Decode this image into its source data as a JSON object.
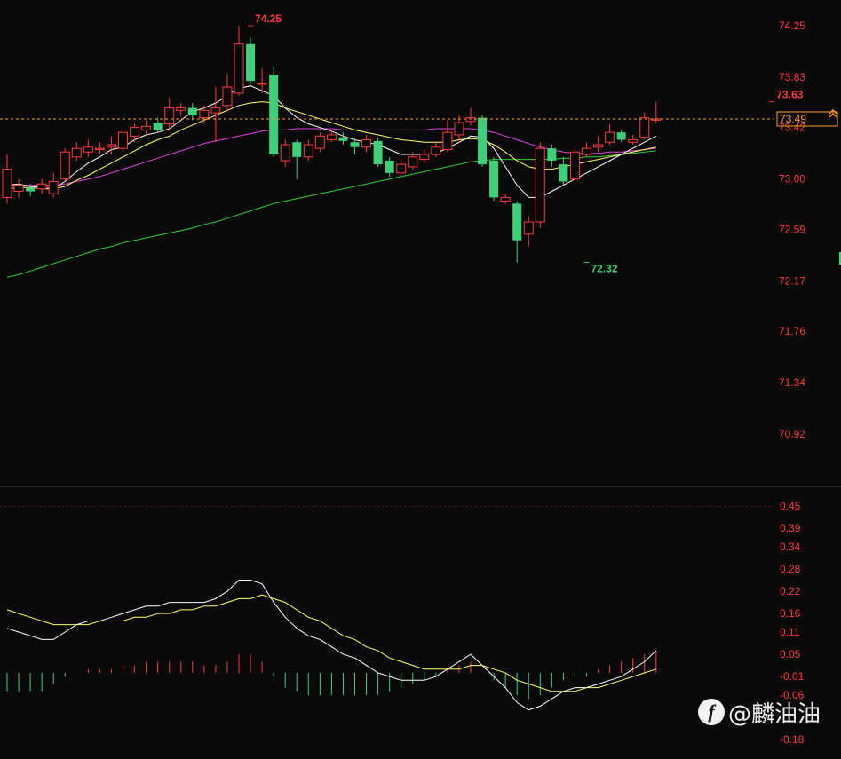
{
  "colors": {
    "background": "#0a0a0a",
    "up": "#ff3b3b",
    "down": "#3fd07a",
    "axis_text": "#ff3b3b",
    "price_line": "#ff9a2e",
    "ma5": "#ffffff",
    "ma10": "#ffff66",
    "ma20": "#e040e0",
    "ma60": "#33cc33",
    "dif": "#ffffff",
    "dea": "#ffff66"
  },
  "chart_data": [
    {
      "type": "candlestick",
      "y_ticks": [
        "74.25",
        "73.83",
        "73.42",
        "73.00",
        "72.59",
        "72.17",
        "71.76",
        "71.34",
        "70.92"
      ],
      "ylim": [
        70.6,
        74.5
      ],
      "grid": false,
      "last_price_label": "73.49",
      "high_marker": {
        "index": 21,
        "value": 74.25,
        "label": "74.25"
      },
      "low_marker": {
        "index": 50,
        "value": 72.32,
        "label": "72.32"
      },
      "recent_high_marker": {
        "index": 66,
        "value": 73.63,
        "label": "73.63"
      },
      "candles": [
        [
          72.85,
          73.08,
          73.2,
          72.8
        ],
        [
          72.9,
          72.95,
          73.0,
          72.85
        ],
        [
          72.93,
          72.9,
          72.96,
          72.86
        ],
        [
          72.92,
          72.96,
          73.0,
          72.88
        ],
        [
          72.88,
          72.98,
          73.05,
          72.85
        ],
        [
          73.0,
          73.22,
          73.25,
          72.98
        ],
        [
          73.18,
          73.25,
          73.3,
          73.15
        ],
        [
          73.22,
          73.26,
          73.32,
          73.18
        ],
        [
          73.24,
          73.25,
          73.3,
          73.2
        ],
        [
          73.26,
          73.28,
          73.35,
          73.2
        ],
        [
          73.25,
          73.38,
          73.4,
          73.22
        ],
        [
          73.35,
          73.42,
          73.45,
          73.3
        ],
        [
          73.4,
          73.43,
          73.48,
          73.36
        ],
        [
          73.46,
          73.4,
          73.5,
          73.38
        ],
        [
          73.45,
          73.58,
          73.66,
          73.4
        ],
        [
          73.56,
          73.58,
          73.62,
          73.52
        ],
        [
          73.58,
          73.52,
          73.62,
          73.48
        ],
        [
          73.5,
          73.56,
          73.6,
          73.45
        ],
        [
          73.54,
          73.58,
          73.75,
          73.3
        ],
        [
          73.6,
          73.75,
          73.86,
          73.55
        ],
        [
          73.7,
          74.1,
          74.25,
          73.68
        ],
        [
          74.1,
          73.8,
          74.15,
          73.78
        ],
        [
          73.78,
          73.78,
          73.9,
          73.7
        ],
        [
          73.85,
          73.2,
          73.92,
          73.18
        ],
        [
          73.15,
          73.28,
          73.32,
          73.1
        ],
        [
          73.3,
          73.18,
          73.32,
          73.0
        ],
        [
          73.18,
          73.28,
          73.32,
          73.15
        ],
        [
          73.25,
          73.35,
          73.38,
          73.22
        ],
        [
          73.32,
          73.36,
          73.4,
          73.3
        ],
        [
          73.34,
          73.31,
          73.38,
          73.28
        ],
        [
          73.3,
          73.26,
          73.33,
          73.2
        ],
        [
          73.26,
          73.32,
          73.36,
          73.22
        ],
        [
          73.31,
          73.12,
          73.34,
          73.1
        ],
        [
          73.15,
          73.05,
          73.18,
          73.02
        ],
        [
          73.05,
          73.12,
          73.16,
          73.02
        ],
        [
          73.1,
          73.18,
          73.22,
          73.08
        ],
        [
          73.16,
          73.2,
          73.24,
          73.14
        ],
        [
          73.2,
          73.26,
          73.3,
          73.18
        ],
        [
          73.24,
          73.38,
          73.48,
          73.22
        ],
        [
          73.36,
          73.46,
          73.52,
          73.32
        ],
        [
          73.47,
          73.5,
          73.58,
          73.44
        ],
        [
          73.5,
          73.12,
          73.52,
          73.1
        ],
        [
          73.15,
          72.85,
          73.18,
          72.82
        ],
        [
          72.82,
          72.85,
          72.88,
          72.8
        ],
        [
          72.8,
          72.5,
          72.82,
          72.32
        ],
        [
          72.55,
          72.65,
          72.7,
          72.45
        ],
        [
          72.65,
          73.25,
          73.3,
          72.6
        ],
        [
          73.25,
          73.15,
          73.28,
          73.1
        ],
        [
          73.12,
          72.98,
          73.18,
          72.95
        ],
        [
          73.0,
          73.22,
          73.25,
          72.98
        ],
        [
          73.2,
          73.25,
          73.3,
          73.18
        ],
        [
          73.26,
          73.28,
          73.35,
          73.22
        ],
        [
          73.3,
          73.38,
          73.45,
          73.28
        ],
        [
          73.38,
          73.32,
          73.4,
          73.3
        ],
        [
          73.3,
          73.32,
          73.36,
          73.28
        ],
        [
          73.34,
          73.5,
          73.54,
          73.32
        ],
        [
          73.48,
          73.49,
          73.63,
          73.46
        ]
      ],
      "ma5": [
        72.95,
        72.96,
        72.94,
        72.93,
        72.92,
        72.98,
        73.06,
        73.13,
        73.18,
        73.24,
        73.26,
        73.32,
        73.36,
        73.38,
        73.41,
        73.48,
        73.55,
        73.58,
        73.62,
        73.68,
        73.74,
        73.76,
        73.72,
        73.68,
        73.58,
        73.5,
        73.45,
        73.42,
        73.39,
        73.35,
        73.32,
        73.3,
        73.28,
        73.24,
        73.2,
        73.2,
        73.2,
        73.21,
        73.25,
        73.3,
        73.35,
        73.34,
        73.25,
        73.1,
        72.95,
        72.85,
        72.85,
        72.9,
        72.95,
        73.0,
        73.05,
        73.1,
        73.15,
        73.2,
        73.25,
        73.3,
        73.35
      ],
      "ma10": [
        72.92,
        72.93,
        72.93,
        72.92,
        72.92,
        72.94,
        72.99,
        73.03,
        73.08,
        73.13,
        73.18,
        73.23,
        73.28,
        73.32,
        73.35,
        73.4,
        73.44,
        73.48,
        73.52,
        73.56,
        73.6,
        73.62,
        73.63,
        73.62,
        73.58,
        73.55,
        73.52,
        73.49,
        73.46,
        73.43,
        73.4,
        73.38,
        73.36,
        73.34,
        73.32,
        73.31,
        73.3,
        73.3,
        73.3,
        73.32,
        73.33,
        73.32,
        73.28,
        73.22,
        73.15,
        73.1,
        73.08,
        73.08,
        73.1,
        73.12,
        73.14,
        73.16,
        73.18,
        73.2,
        73.22,
        73.24,
        73.26
      ],
      "ma20": [
        72.95,
        72.95,
        72.95,
        72.95,
        72.95,
        72.96,
        72.98,
        73.0,
        73.02,
        73.05,
        73.08,
        73.11,
        73.14,
        73.17,
        73.2,
        73.23,
        73.26,
        73.29,
        73.31,
        73.33,
        73.35,
        73.37,
        73.39,
        73.4,
        73.4,
        73.41,
        73.41,
        73.41,
        73.41,
        73.4,
        73.4,
        73.4,
        73.4,
        73.4,
        73.4,
        73.4,
        73.4,
        73.41,
        73.41,
        73.41,
        73.41,
        73.4,
        73.38,
        73.35,
        73.32,
        73.29,
        73.26,
        73.24,
        73.22,
        73.21,
        73.21,
        73.21,
        73.22,
        73.22,
        73.23,
        73.24,
        73.25
      ],
      "ma60": [
        72.2,
        72.22,
        72.25,
        72.28,
        72.31,
        72.34,
        72.37,
        72.4,
        72.43,
        72.45,
        72.48,
        72.5,
        72.52,
        72.54,
        72.56,
        72.58,
        72.6,
        72.63,
        72.65,
        72.68,
        72.71,
        72.74,
        72.77,
        72.8,
        72.82,
        72.84,
        72.86,
        72.88,
        72.9,
        72.92,
        72.94,
        72.96,
        72.98,
        73.0,
        73.02,
        73.04,
        73.06,
        73.08,
        73.1,
        73.12,
        73.14,
        73.15,
        73.16,
        73.16,
        73.16,
        73.16,
        73.16,
        73.16,
        73.17,
        73.17,
        73.18,
        73.18,
        73.19,
        73.2,
        73.21,
        73.22,
        73.23
      ]
    },
    {
      "type": "bar",
      "y_ticks": [
        "0.45",
        "0.39",
        "0.34",
        "0.28",
        "0.22",
        "0.16",
        "0.11",
        "0.05",
        "-0.01",
        "-0.06",
        "-0.18"
      ],
      "ylim": [
        -0.21,
        0.47
      ],
      "dif": [
        0.12,
        0.11,
        0.1,
        0.09,
        0.09,
        0.11,
        0.13,
        0.14,
        0.14,
        0.15,
        0.16,
        0.17,
        0.18,
        0.18,
        0.19,
        0.19,
        0.19,
        0.19,
        0.2,
        0.22,
        0.25,
        0.25,
        0.24,
        0.19,
        0.15,
        0.12,
        0.1,
        0.09,
        0.07,
        0.05,
        0.04,
        0.02,
        0.0,
        -0.01,
        -0.02,
        -0.02,
        -0.02,
        -0.01,
        0.01,
        0.03,
        0.05,
        0.02,
        -0.01,
        -0.04,
        -0.08,
        -0.1,
        -0.09,
        -0.07,
        -0.05,
        -0.04,
        -0.04,
        -0.03,
        -0.02,
        -0.01,
        0.01,
        0.03,
        0.06
      ],
      "dea": [
        0.17,
        0.16,
        0.15,
        0.14,
        0.13,
        0.13,
        0.13,
        0.13,
        0.14,
        0.14,
        0.14,
        0.15,
        0.15,
        0.16,
        0.16,
        0.17,
        0.17,
        0.18,
        0.18,
        0.19,
        0.2,
        0.2,
        0.21,
        0.2,
        0.19,
        0.17,
        0.15,
        0.14,
        0.12,
        0.1,
        0.09,
        0.07,
        0.06,
        0.04,
        0.03,
        0.02,
        0.01,
        0.01,
        0.01,
        0.01,
        0.02,
        0.02,
        0.01,
        0.0,
        -0.02,
        -0.03,
        -0.04,
        -0.05,
        -0.05,
        -0.05,
        -0.04,
        -0.04,
        -0.03,
        -0.02,
        -0.01,
        0.0,
        0.01
      ],
      "hist": [
        -0.05,
        -0.05,
        -0.05,
        -0.05,
        -0.03,
        -0.01,
        0.0,
        0.01,
        0.01,
        0.01,
        0.02,
        0.02,
        0.03,
        0.03,
        0.03,
        0.03,
        0.03,
        0.02,
        0.02,
        0.03,
        0.05,
        0.05,
        0.03,
        -0.01,
        -0.04,
        -0.05,
        -0.06,
        -0.06,
        -0.06,
        -0.06,
        -0.06,
        -0.06,
        -0.06,
        -0.05,
        -0.04,
        -0.03,
        -0.02,
        -0.01,
        0.01,
        0.02,
        0.03,
        0.0,
        -0.02,
        -0.04,
        -0.06,
        -0.07,
        -0.06,
        -0.04,
        -0.02,
        -0.01,
        -0.01,
        0.01,
        0.02,
        0.03,
        0.04,
        0.05,
        0.06
      ]
    }
  ],
  "watermark": {
    "icon": "f",
    "text": "@麟油油"
  }
}
